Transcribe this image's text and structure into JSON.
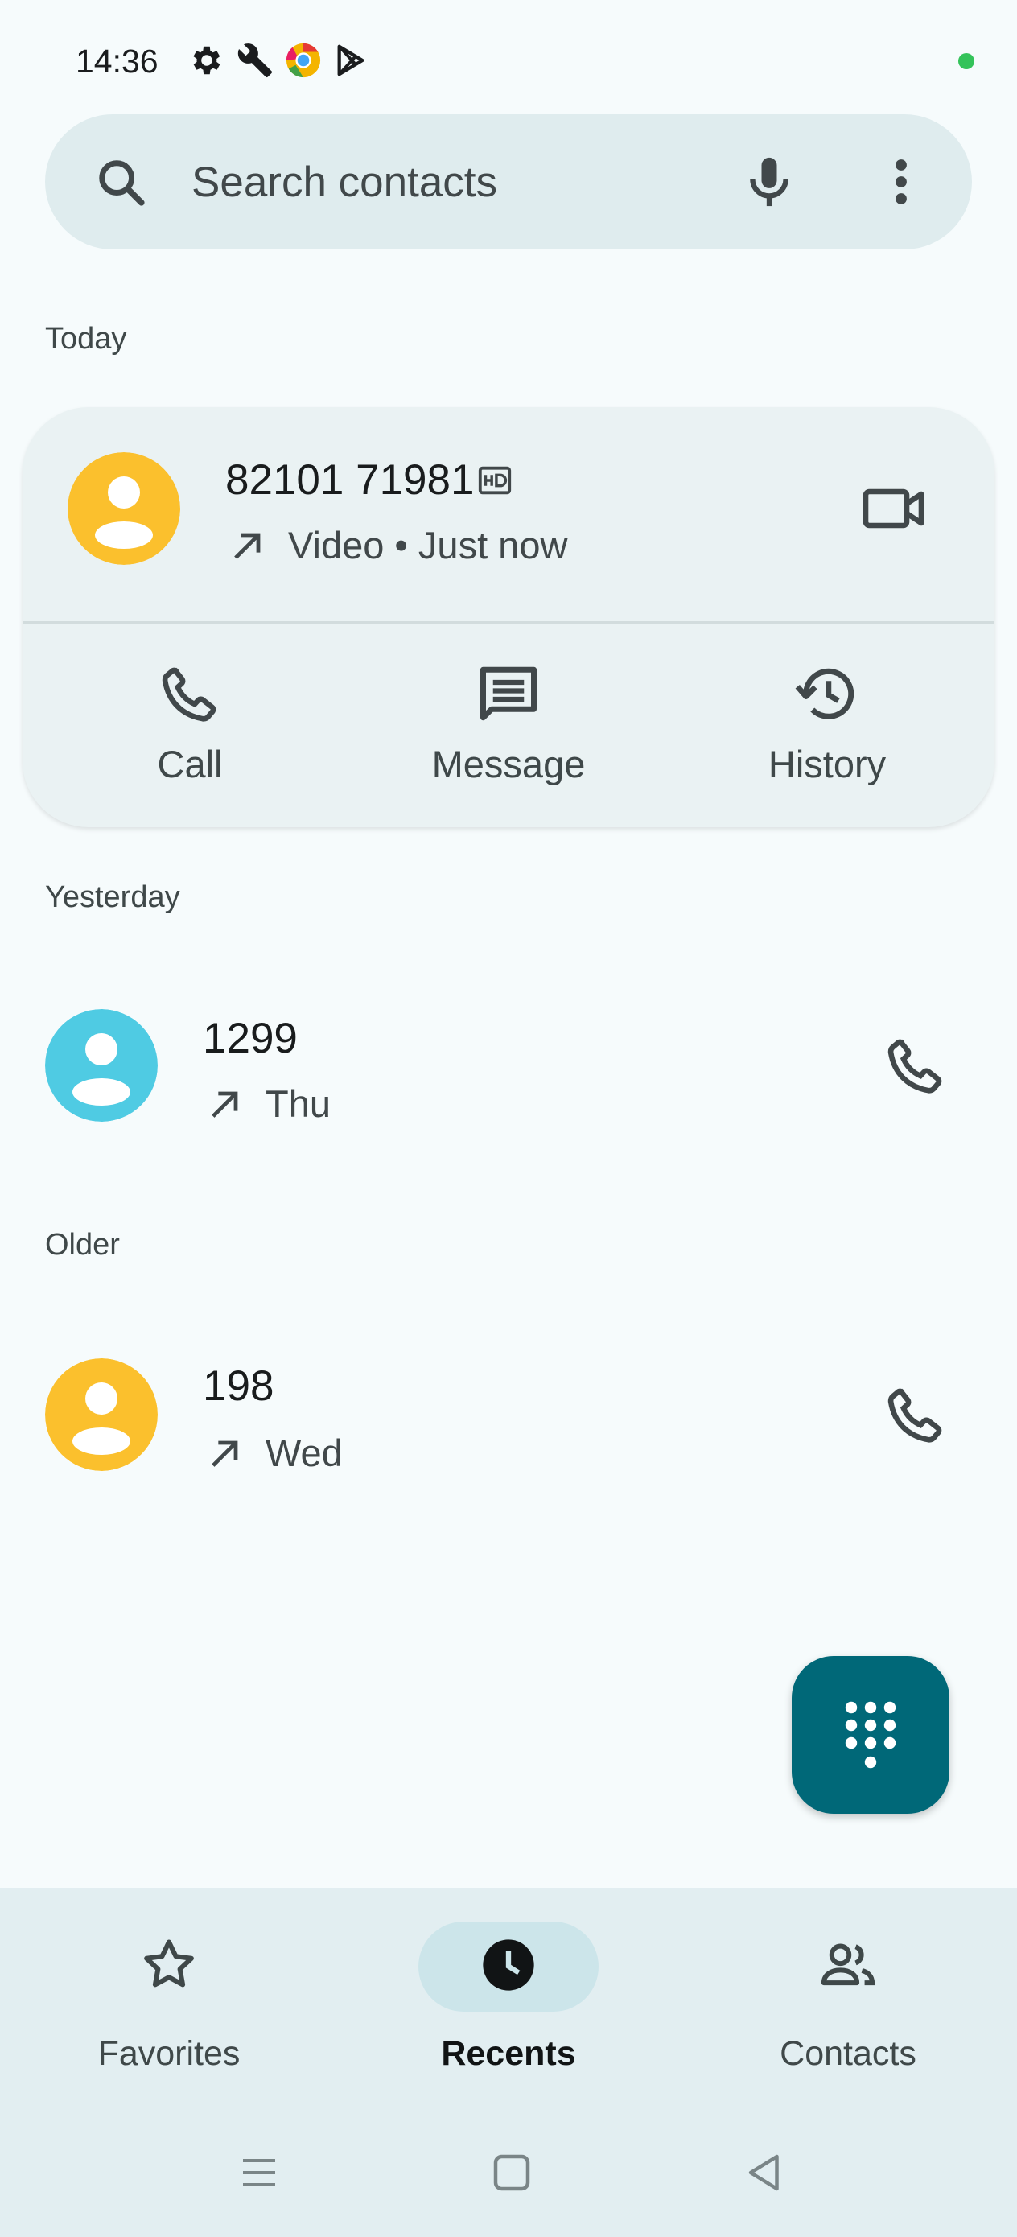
{
  "status_bar": {
    "time": "14:36",
    "icons": [
      "gear-icon",
      "wrench-icon",
      "chrome-like-app-icon",
      "play-store-icon"
    ],
    "indicator_color": "#34c35a"
  },
  "search": {
    "placeholder": "Search contacts",
    "icons": [
      "search-icon",
      "mic-icon",
      "more-vert-icon"
    ]
  },
  "sections": {
    "today": "Today",
    "yesterday": "Yesterday",
    "older": "Older"
  },
  "calls": [
    {
      "number": "82101 71981",
      "badge": "HD",
      "direction": "outgoing",
      "detail": "Video • Just now",
      "avatar_color": "#fbc02d",
      "action_icon": "videocam-icon",
      "expanded": true
    },
    {
      "number": "1299",
      "direction": "outgoing",
      "detail": "Thu",
      "avatar_color": "#4fcbe3",
      "action_icon": "phone-icon"
    },
    {
      "number": "198",
      "direction": "outgoing",
      "detail": "Wed",
      "avatar_color": "#fbc02d",
      "action_icon": "phone-icon"
    }
  ],
  "card_actions": [
    {
      "label": "Call",
      "icon": "phone-icon"
    },
    {
      "label": "Message",
      "icon": "message-icon"
    },
    {
      "label": "History",
      "icon": "history-icon"
    }
  ],
  "fab": {
    "icon": "dialpad-icon",
    "color": "#006878"
  },
  "bottom_nav": {
    "items": [
      {
        "label": "Favorites",
        "icon": "star-outline-icon",
        "active": false
      },
      {
        "label": "Recents",
        "icon": "clock-icon",
        "active": true
      },
      {
        "label": "Contacts",
        "icon": "people-icon",
        "active": false
      }
    ]
  },
  "system_nav": [
    "menu-icon",
    "home-icon",
    "back-icon"
  ]
}
